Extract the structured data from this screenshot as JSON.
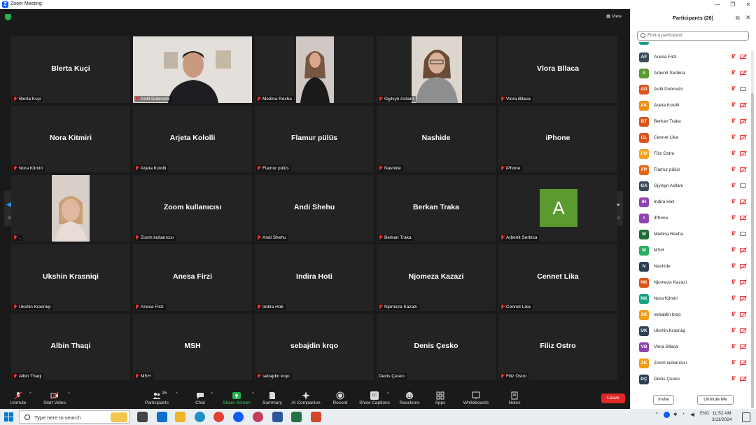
{
  "window": {
    "title": "Zoom Meeting",
    "min": "—",
    "restore": "❐",
    "close": "✕"
  },
  "view_button": "View",
  "page_left": "2/2",
  "page_right": "2/2",
  "tiles": [
    {
      "big": "Blerta Kuçi",
      "label": "Blerta Kuçi"
    },
    {
      "big": "",
      "label": "Ardit Dobroshi"
    },
    {
      "big": "",
      "label": "Medina Rexha"
    },
    {
      "big": "",
      "label": "Gjylsyn Asllani"
    },
    {
      "big": "Vlora Bllaca",
      "label": "Vlora Bllaca"
    },
    {
      "big": "Nora Kitmiri",
      "label": "Nora Kitmiri"
    },
    {
      "big": "Arjeta Kololli",
      "label": "Arjeta Kololli"
    },
    {
      "big": "Flamur pülüs",
      "label": "Flamur pülüs"
    },
    {
      "big": "Nashide",
      "label": "Nashide"
    },
    {
      "big": "iPhone",
      "label": "iPhone"
    },
    {
      "big": "",
      "label": "."
    },
    {
      "big": "Zoom kullanıcısı",
      "label": "Zoom kullanıcısı"
    },
    {
      "big": "Andi Shehu",
      "label": "Andi Shehu"
    },
    {
      "big": "Berkan Traka",
      "label": "Berkan Traka"
    },
    {
      "big": "",
      "label": "Arbenit Serbica",
      "avatar": "A"
    },
    {
      "big": "Ukshin Krasniqi",
      "label": "Ukshin Krasniqi"
    },
    {
      "big": "Anesa Firzi",
      "label": "Anesa Firzi"
    },
    {
      "big": "Indira Hoti",
      "label": "Indira Hoti"
    },
    {
      "big": "Njomeza Kazazi",
      "label": "Njomeza Kazazi"
    },
    {
      "big": "Cennet Lika",
      "label": "Cennet Lika"
    },
    {
      "big": "Albin Thaqi",
      "label": "Albin Thaqi"
    },
    {
      "big": "MSH",
      "label": "MSH"
    },
    {
      "big": "sebajdin krqo",
      "label": "sebajdin krqo"
    },
    {
      "big": "Denis Çesko",
      "label": "Denis Çesko"
    },
    {
      "big": "Filiz Ostro",
      "label": "Filiz Ostro"
    }
  ],
  "toolbar": {
    "unmute": "Unmute",
    "start_video": "Start Video",
    "participants": "Participants",
    "participants_count": "26",
    "chat": "Chat",
    "share_screen": "Share Screen",
    "summary": "Summary",
    "ai_companion": "AI Companion",
    "record": "Record",
    "show_captions": "Show Captions",
    "reactions": "Reactions",
    "apps": "Apps",
    "whiteboards": "Whiteboards",
    "notes": "Notes",
    "leave": "Leave",
    "cc": "CC"
  },
  "panel": {
    "title": "Participants (26)",
    "search_placeholder": "Find a participant",
    "invite": "Invite",
    "unmute_me": "Unmute Me",
    "participants": [
      {
        "initials": "AF",
        "name": "Anesa Firzi",
        "color": "#3d4a5c",
        "video": "off"
      },
      {
        "initials": "A",
        "name": "Arbenit Serbica",
        "color": "#5a9a2f",
        "video": "off"
      },
      {
        "initials": "AD",
        "name": "Ardit Dobroshi",
        "color": "#e0531f",
        "video": "on"
      },
      {
        "initials": "AK",
        "name": "Arjeta Kololli",
        "color": "#f28c0f",
        "video": "off"
      },
      {
        "initials": "BT",
        "name": "Berkan Traka",
        "color": "#d9541a",
        "video": "off"
      },
      {
        "initials": "CL",
        "name": "Cennet Lika",
        "color": "#d9541a",
        "video": "off"
      },
      {
        "initials": "FO",
        "name": "Filiz Ostro",
        "color": "#f5a31a",
        "video": "off"
      },
      {
        "initials": "FP",
        "name": "Flamur pülüs",
        "color": "#e8671a",
        "video": "off"
      },
      {
        "initials": "GA",
        "name": "Gjylsyn Asllani",
        "color": "#3d4a5c",
        "video": "on"
      },
      {
        "initials": "IH",
        "name": "Indira Hoti",
        "color": "#8e44ad",
        "video": "off"
      },
      {
        "initials": "I",
        "name": "iPhone",
        "color": "#8e44ad",
        "video": "off"
      },
      {
        "initials": "M",
        "name": "Medina Rexha",
        "color": "#1e6b3a",
        "video": "on"
      },
      {
        "initials": "M",
        "name": "MSH",
        "color": "#27ae60",
        "video": "off"
      },
      {
        "initials": "N",
        "name": "Nashide",
        "color": "#2c3e50",
        "video": "off"
      },
      {
        "initials": "NK",
        "name": "Njomeza Kazazi",
        "color": "#d9541a",
        "video": "off"
      },
      {
        "initials": "NK",
        "name": "Nora Kitmiri",
        "color": "#16a085",
        "video": "off"
      },
      {
        "initials": "SK",
        "name": "sebajdin krqo",
        "color": "#f39c12",
        "video": "off"
      },
      {
        "initials": "UK",
        "name": "Ukshin Krasniqi",
        "color": "#2c3e50",
        "video": "off"
      },
      {
        "initials": "VB",
        "name": "Vlora Bllaca",
        "color": "#8e44ad",
        "video": "off"
      },
      {
        "initials": "ZK",
        "name": "Zoom kullanıcısı",
        "color": "#f39c12",
        "video": "off"
      },
      {
        "initials": "DÇ",
        "name": "Denis Çesko",
        "color": "#2c3e50",
        "video": "off"
      }
    ]
  },
  "taskbar": {
    "search_placeholder": "Type here to search",
    "time": "11:52 AM",
    "date": "3/11/2024",
    "lang": "ENG"
  }
}
